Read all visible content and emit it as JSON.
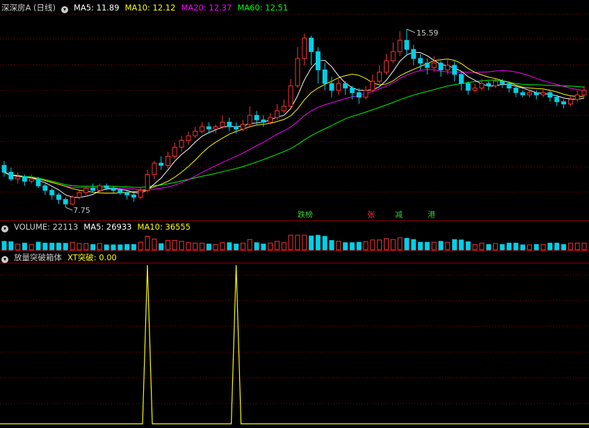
{
  "header": {
    "stock_title": "深深房A (日线)",
    "ma5": "MA5: 11.89",
    "ma10": "MA10: 12.12",
    "ma20": "MA20: 12.37",
    "ma60": "MA60: 12.51"
  },
  "volume_header": {
    "volume": "VOLUME: 22113",
    "ma5": "MA5: 26933",
    "ma10": "MA10: 36555"
  },
  "indicator_header": {
    "name": "放量突破箱体",
    "xt": "XT突破: 0.00"
  },
  "annotations": {
    "high_label": "15.59",
    "low_label": "7.75"
  },
  "tags": [
    {
      "text": "跌榜",
      "color": "#33cc33"
    },
    {
      "text": "张",
      "color": "#ff3333"
    },
    {
      "text": "减",
      "color": "#33cc33"
    },
    {
      "text": "港",
      "color": "#33cc33"
    }
  ],
  "colors": {
    "up": "#ff3333",
    "down": "#00d0e8",
    "ma5": "#ffffff",
    "ma10": "#ffff00",
    "ma20": "#ff00ff",
    "ma60": "#00ff00",
    "grid": "#a00000",
    "signal": "#ffff00"
  },
  "chart_data": [
    {
      "type": "candlestick",
      "note_series": "ohlc approximated from image",
      "y_range": [
        7.2,
        16.2
      ],
      "candles": [
        [
          9.6,
          9.3,
          9.8,
          9.1
        ],
        [
          9.3,
          9.0,
          9.5,
          8.9
        ],
        [
          9.0,
          9.1,
          9.3,
          8.8
        ],
        [
          9.1,
          8.9,
          9.2,
          8.7
        ],
        [
          8.9,
          9.0,
          9.2,
          8.8
        ],
        [
          9.0,
          8.7,
          9.1,
          8.6
        ],
        [
          8.7,
          8.5,
          8.8,
          8.3
        ],
        [
          8.5,
          8.3,
          8.6,
          8.1
        ],
        [
          8.3,
          8.1,
          8.4,
          7.9
        ],
        [
          8.1,
          7.9,
          8.2,
          7.75
        ],
        [
          7.9,
          8.2,
          8.3,
          7.85
        ],
        [
          8.2,
          8.4,
          8.5,
          8.1
        ],
        [
          8.4,
          8.6,
          8.7,
          8.3
        ],
        [
          8.6,
          8.5,
          8.8,
          8.4
        ],
        [
          8.5,
          8.7,
          8.8,
          8.4
        ],
        [
          8.7,
          8.6,
          8.8,
          8.5
        ],
        [
          8.6,
          8.5,
          8.7,
          8.4
        ],
        [
          8.5,
          8.4,
          8.6,
          8.3
        ],
        [
          8.4,
          8.3,
          8.5,
          8.1
        ],
        [
          8.3,
          8.2,
          8.4,
          8.0
        ],
        [
          8.2,
          8.5,
          8.6,
          8.1
        ],
        [
          8.5,
          9.2,
          9.4,
          8.4
        ],
        [
          9.2,
          9.7,
          9.8,
          9.0
        ],
        [
          9.7,
          9.6,
          10.0,
          9.4
        ],
        [
          9.6,
          10.0,
          10.2,
          9.5
        ],
        [
          10.0,
          10.4,
          10.6,
          9.9
        ],
        [
          10.4,
          10.7,
          10.9,
          10.2
        ],
        [
          10.7,
          10.9,
          11.1,
          10.5
        ],
        [
          10.9,
          11.1,
          11.3,
          10.8
        ],
        [
          11.1,
          11.3,
          11.5,
          11.0
        ],
        [
          11.3,
          11.2,
          11.5,
          11.0
        ],
        [
          11.2,
          11.3,
          11.4,
          11.0
        ],
        [
          11.3,
          11.5,
          11.8,
          11.2
        ],
        [
          11.5,
          11.3,
          11.7,
          11.1
        ],
        [
          11.3,
          11.2,
          11.5,
          11.0
        ],
        [
          11.2,
          11.4,
          11.6,
          11.1
        ],
        [
          11.4,
          11.8,
          12.2,
          11.3
        ],
        [
          11.8,
          11.6,
          12.0,
          11.4
        ],
        [
          11.6,
          11.5,
          11.8,
          11.3
        ],
        [
          11.5,
          11.7,
          11.9,
          11.4
        ],
        [
          11.7,
          12.0,
          12.3,
          11.6
        ],
        [
          12.0,
          12.2,
          12.5,
          11.9
        ],
        [
          12.2,
          13.1,
          13.4,
          12.1
        ],
        [
          13.1,
          14.3,
          14.8,
          13.0
        ],
        [
          14.3,
          15.2,
          15.4,
          14.0
        ],
        [
          15.2,
          14.6,
          15.3,
          14.0
        ],
        [
          14.6,
          13.8,
          14.8,
          13.2
        ],
        [
          13.8,
          13.2,
          14.1,
          12.9
        ],
        [
          13.2,
          12.9,
          13.5,
          12.6
        ],
        [
          12.9,
          13.2,
          13.4,
          12.7
        ],
        [
          13.2,
          13.0,
          13.3,
          12.7
        ],
        [
          13.0,
          12.8,
          13.1,
          12.5
        ],
        [
          12.8,
          12.6,
          13.0,
          12.3
        ],
        [
          12.6,
          12.9,
          13.1,
          12.5
        ],
        [
          12.9,
          13.3,
          13.6,
          12.8
        ],
        [
          13.3,
          13.7,
          14.0,
          13.2
        ],
        [
          13.7,
          14.2,
          14.5,
          13.6
        ],
        [
          14.2,
          14.6,
          15.0,
          14.1
        ],
        [
          14.6,
          15.1,
          15.5,
          14.4
        ],
        [
          15.1,
          14.7,
          15.59,
          14.4
        ],
        [
          14.7,
          14.3,
          14.9,
          14.0
        ],
        [
          14.3,
          14.1,
          14.5,
          13.8
        ],
        [
          14.1,
          13.9,
          14.3,
          13.6
        ],
        [
          13.9,
          14.1,
          14.4,
          13.7
        ],
        [
          14.1,
          13.8,
          14.2,
          13.5
        ],
        [
          13.8,
          14.0,
          14.3,
          13.6
        ],
        [
          14.0,
          13.6,
          14.2,
          13.3
        ],
        [
          13.6,
          13.2,
          13.7,
          12.9
        ],
        [
          13.2,
          12.9,
          13.3,
          12.7
        ],
        [
          12.9,
          13.0,
          13.2,
          12.8
        ],
        [
          13.0,
          13.2,
          13.4,
          12.9
        ],
        [
          13.2,
          13.1,
          13.3,
          12.9
        ],
        [
          13.1,
          13.3,
          13.4,
          13.0
        ],
        [
          13.3,
          13.2,
          13.4,
          13.0
        ],
        [
          13.2,
          13.0,
          13.3,
          12.8
        ],
        [
          13.0,
          12.8,
          13.1,
          12.6
        ],
        [
          12.8,
          12.7,
          12.9,
          12.6
        ],
        [
          12.7,
          12.8,
          12.9,
          12.6
        ],
        [
          12.8,
          12.7,
          12.9,
          12.5
        ],
        [
          12.7,
          12.8,
          13.0,
          12.6
        ],
        [
          12.8,
          12.6,
          12.9,
          12.4
        ],
        [
          12.6,
          12.4,
          12.7,
          12.2
        ],
        [
          12.4,
          12.3,
          12.5,
          12.1
        ],
        [
          12.3,
          12.5,
          12.7,
          12.2
        ],
        [
          12.5,
          12.7,
          12.9,
          12.4
        ],
        [
          12.7,
          12.9,
          13.1,
          12.6
        ]
      ]
    },
    {
      "type": "line",
      "name": "XT突破",
      "spikes_at_index": [
        21,
        34
      ],
      "y_range": [
        0,
        1
      ]
    }
  ]
}
